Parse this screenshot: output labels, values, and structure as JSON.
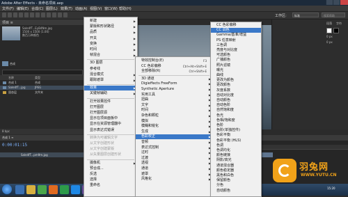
{
  "window": {
    "title": "Adobe After Effects - 未命名项目.aep"
  },
  "menubar": {
    "items": [
      "文件(F)",
      "编辑(E)",
      "合成(C)",
      "图层(L)",
      "效果(T)",
      "动画(A)",
      "视图(V)",
      "窗口(W)",
      "帮助(H)"
    ]
  },
  "toolbar": {
    "workspace_label": "工作区:",
    "workspace_value": "标准",
    "search_placeholder": "搜索帮助"
  },
  "project": {
    "tab": "项目 ≡",
    "asset_name": "Sale4fT...EyB4Nm.jpg",
    "asset_info": [
      "1500 x 1500 (1.00)",
      "数百万种颜色"
    ],
    "comp_label": "合成",
    "columns": [
      "名称",
      "类型"
    ],
    "rows": [
      {
        "name": "合成 1",
        "type": "合成",
        "selected": false
      },
      {
        "name": "Sale4fT...jpg",
        "type": "JPEG",
        "selected": true
      },
      {
        "name": "固态层",
        "type": "文件夹",
        "selected": false
      }
    ],
    "bpc": "8 bpc"
  },
  "viewer": {
    "tab": "合成: 合成 1"
  },
  "right_panel": {
    "rows": [
      "段落",
      "字符",
      "0 px",
      "0 px"
    ]
  },
  "timeline": {
    "tab": "合成 1 ≡",
    "timecode": "0:00:01:15",
    "layer": "Sale4fT...pm9m.jpg"
  },
  "menu_layer": {
    "items": [
      {
        "label": "新建",
        "arrow": true
      },
      {
        "label": "蒙版和形状路径",
        "arrow": true
      },
      {
        "label": "品质",
        "arrow": true
      },
      {
        "label": "开关",
        "arrow": true
      },
      {
        "label": "变换",
        "arrow": true
      },
      {
        "label": "时间",
        "arrow": true
      },
      {
        "label": "帧混合",
        "arrow": true
      },
      {
        "label": "3D 图层"
      },
      {
        "label": "参考线"
      },
      {
        "label": "混合模式",
        "arrow": true
      },
      {
        "label": "跟踪遮罩",
        "arrow": true
      },
      {
        "label": "效果",
        "arrow": true,
        "highlight": true
      },
      {
        "label": "关键帧辅助",
        "arrow": true
      },
      {
        "label": "打开效果控件"
      },
      {
        "label": "打开图层"
      },
      {
        "label": "打开图层源"
      },
      {
        "label": "显示在项目面板中"
      },
      {
        "label": "显示在资源管理器中"
      },
      {
        "label": "显示表达式错误"
      },
      {
        "label": "转换为可编辑文字",
        "disabled": true
      },
      {
        "label": "从文字创建形状",
        "disabled": true
      },
      {
        "label": "从文字创建蒙版",
        "disabled": true
      },
      {
        "label": "从矢量图层创建形状",
        "disabled": true
      },
      {
        "label": "摄像机",
        "arrow": true
      },
      {
        "label": "预合成..."
      },
      {
        "label": "反选"
      },
      {
        "label": "选择"
      },
      {
        "label": "重命名"
      }
    ]
  },
  "menu_effect": {
    "items": [
      {
        "label": "特效控制台(E)",
        "shortcut": "F3"
      },
      {
        "label": "CC 色彩偏移",
        "shortcut": "Ctrl+Alt+Shift+E"
      },
      {
        "label": "全部移除(R)",
        "shortcut": "Ctrl+Shift+E"
      },
      {
        "label": "3D 通道",
        "arrow": true
      },
      {
        "label": "Digieffects FreeForm",
        "arrow": true
      },
      {
        "label": "Synthetic Aperture",
        "arrow": true
      },
      {
        "label": "实用工具",
        "arrow": true
      },
      {
        "label": "扭曲",
        "arrow": true
      },
      {
        "label": "文字",
        "arrow": true
      },
      {
        "label": "时间",
        "arrow": true
      },
      {
        "label": "杂色和颗粒",
        "arrow": true
      },
      {
        "label": "模拟",
        "arrow": true
      },
      {
        "label": "模糊和锐化",
        "arrow": true
      },
      {
        "label": "生成",
        "arrow": true
      },
      {
        "label": "色彩校正",
        "arrow": true,
        "highlight": true
      },
      {
        "label": "音频",
        "arrow": true
      },
      {
        "label": "表达式控制",
        "arrow": true
      },
      {
        "label": "过时",
        "arrow": true
      },
      {
        "label": "过渡",
        "arrow": true
      },
      {
        "label": "透视",
        "arrow": true
      },
      {
        "label": "通道",
        "arrow": true
      },
      {
        "label": "遮罩",
        "arrow": true
      },
      {
        "label": "风格化",
        "arrow": true
      }
    ]
  },
  "menu_color": {
    "items": [
      {
        "label": "CC 色彩偏移"
      },
      {
        "label": "CC 调色",
        "highlight": true
      },
      {
        "label": "Gamma/基准/增益"
      },
      {
        "label": "PS 任意映射"
      },
      {
        "label": "三色调"
      },
      {
        "label": "亮度与对比度"
      },
      {
        "label": "可选颜色"
      },
      {
        "label": "广播颜色"
      },
      {
        "label": "照片滤镜"
      },
      {
        "label": "曝光"
      },
      {
        "label": "曲线"
      },
      {
        "label": "更改为颜色"
      },
      {
        "label": "更改颜色"
      },
      {
        "label": "灰度系数"
      },
      {
        "label": "自动对比度"
      },
      {
        "label": "自动颜色"
      },
      {
        "label": "自动色阶"
      },
      {
        "label": "自然饱和度"
      },
      {
        "label": "色光"
      },
      {
        "label": "色相/饱和度"
      },
      {
        "label": "色阶"
      },
      {
        "label": "色阶(单独控件)"
      },
      {
        "label": "色彩平衡"
      },
      {
        "label": "色彩平衡 (HLS)"
      },
      {
        "label": "色调"
      },
      {
        "label": "色调均化"
      },
      {
        "label": "颜色链接"
      },
      {
        "label": "阴影/高光"
      },
      {
        "label": "通道混合器"
      },
      {
        "label": "颜色稳定器"
      },
      {
        "label": "黑色和白色"
      },
      {
        "label": "保留颜色"
      },
      {
        "label": "分色"
      },
      {
        "label": "自动颜色"
      }
    ]
  },
  "watermark": {
    "brand": "羽兔网",
    "url": "WWW.YUTU.CN"
  },
  "taskbar": {
    "clock": "15:20"
  }
}
